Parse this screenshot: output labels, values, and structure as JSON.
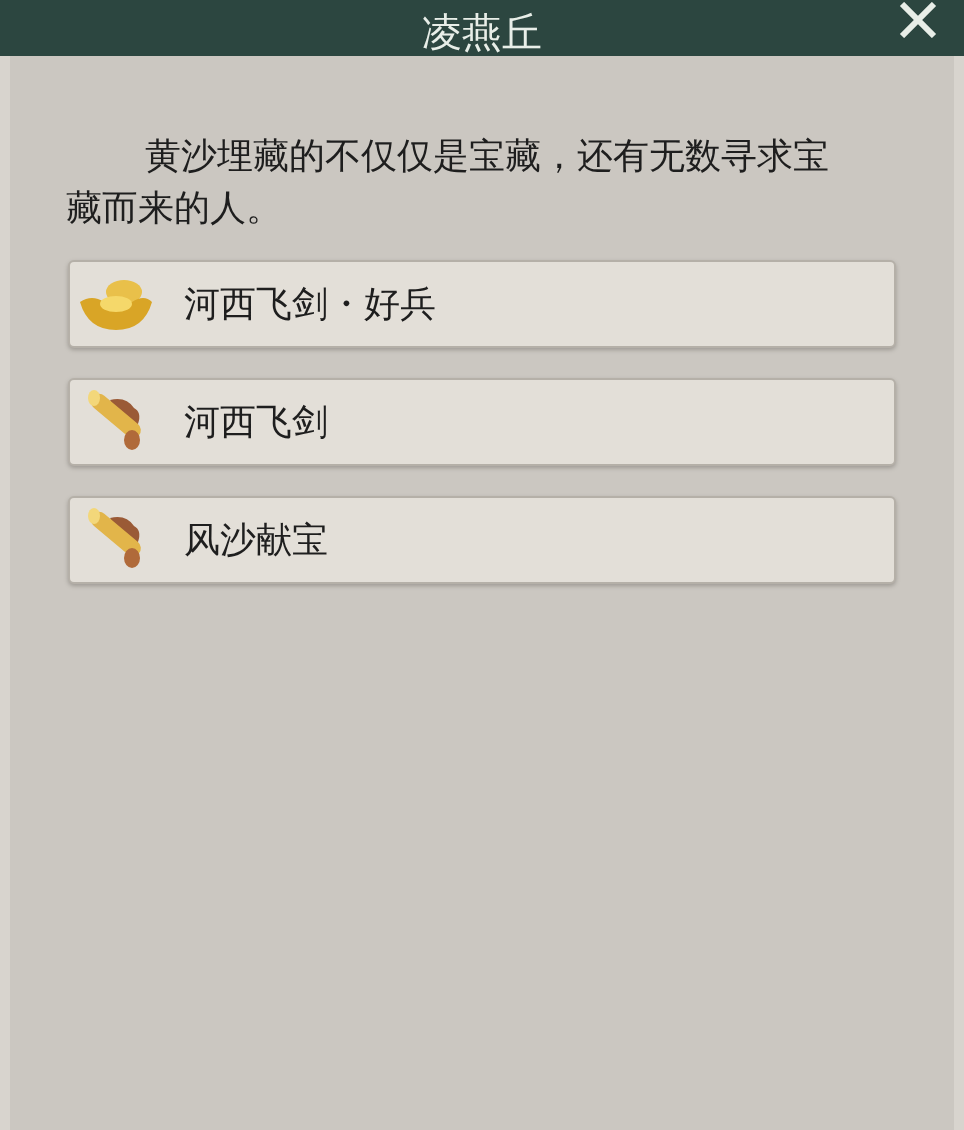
{
  "window": {
    "title": "凌燕丘"
  },
  "description": "黄沙埋藏的不仅仅是宝藏，还有无数寻求宝藏而来的人。",
  "options": [
    {
      "kind": "ingot",
      "label": "河西飞剑・好兵"
    },
    {
      "kind": "scroll",
      "label": "河西飞剑"
    },
    {
      "kind": "scroll",
      "label": "风沙献宝"
    }
  ]
}
